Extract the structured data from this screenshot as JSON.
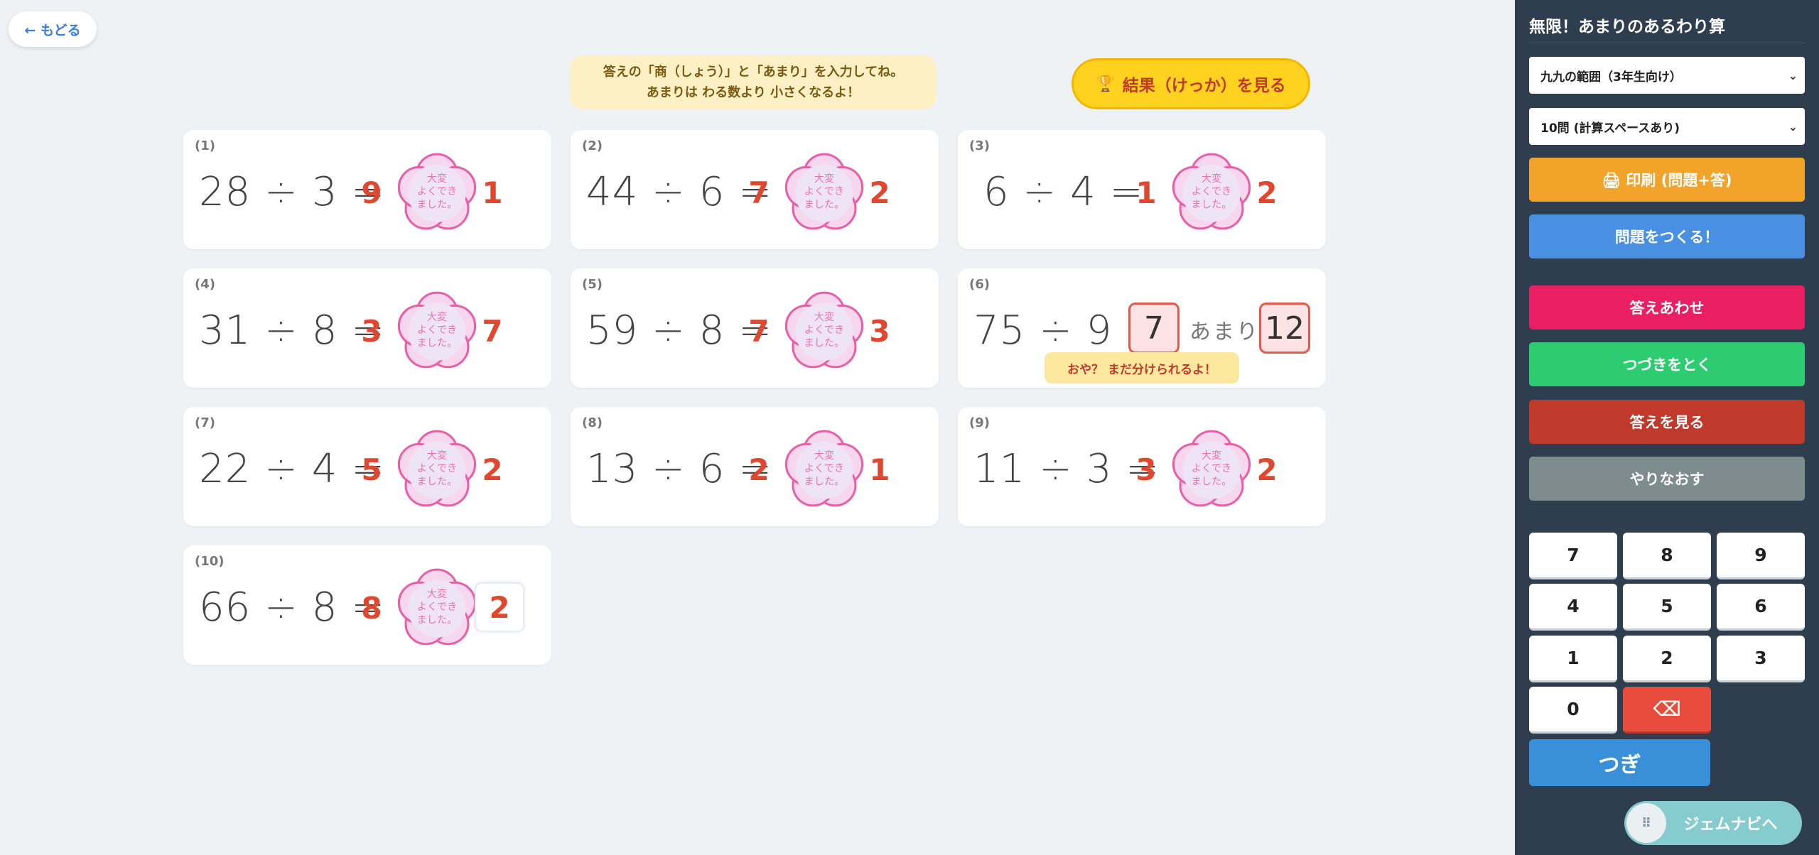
{
  "back_button": {
    "label": "← もどる"
  },
  "instruction": {
    "line1": "答えの「商（しょう）」と「あまり」を入力してね。",
    "line2": "あまりは わる数より 小さくなるよ！"
  },
  "results_button": {
    "icon": "trophy-icon",
    "label": "結果（けっか）を見る"
  },
  "problems": [
    {
      "num": "(1)",
      "expr": "28 ÷ 3 =",
      "quotient": "9",
      "remainder": "1"
    },
    {
      "num": "(2)",
      "expr": "44 ÷ 6 =",
      "quotient": "7",
      "remainder": "2"
    },
    {
      "num": "(3)",
      "expr": "6 ÷ 4 =",
      "quotient": "1",
      "remainder": "2"
    },
    {
      "num": "(4)",
      "expr": "31 ÷ 8 =",
      "quotient": "3",
      "remainder": "7"
    },
    {
      "num": "(5)",
      "expr": "59 ÷ 8 =",
      "quotient": "7",
      "remainder": "3"
    },
    {
      "num": "(6)",
      "expr": "75 ÷ 9 =",
      "quotient": "7",
      "remainder_label": "あまり",
      "remainder": "12",
      "hint": "おや？ まだ分けられるよ！"
    },
    {
      "num": "(7)",
      "expr": "22 ÷ 4 =",
      "quotient": "5",
      "remainder": "2"
    },
    {
      "num": "(8)",
      "expr": "13 ÷ 6 =",
      "quotient": "2",
      "remainder": "1"
    },
    {
      "num": "(9)",
      "expr": "11 ÷ 3 =",
      "quotient": "3",
      "remainder": "2"
    },
    {
      "num": "(10)",
      "expr": "66 ÷ 8 =",
      "quotient": "8",
      "remainder": "2"
    }
  ],
  "stamp": {
    "text_lines": [
      "大変",
      "よくでき",
      "ました。"
    ],
    "color": "#e85fa8"
  },
  "panel": {
    "title": "無限！あまりのあるわり算",
    "range_select": "九九の範囲（3年生向け）",
    "count_select": "10問 (計算スペースあり)",
    "print_button": "🖨 印刷 (問題+答)",
    "create_button": "問題をつくる！",
    "check_button": "答えあわせ",
    "continue_button": "つづきをとく",
    "show_answer_button": "答えを見る",
    "retry_button": "やりなおす",
    "keypad": [
      "7",
      "8",
      "9",
      "4",
      "5",
      "6",
      "1",
      "2",
      "3",
      "0"
    ],
    "delete_key": "⌫",
    "next_button": "つぎ",
    "gem_nav": "ジェムナビへ"
  },
  "colors": {
    "answer_red": "#e0472f",
    "print": "#f2a32a",
    "create": "#4a90e2",
    "check": "#e91e63",
    "continue": "#2ecc71",
    "show_answer": "#c0392b",
    "retry": "#7f8c8d",
    "panel_bg": "#2f3e4e"
  }
}
